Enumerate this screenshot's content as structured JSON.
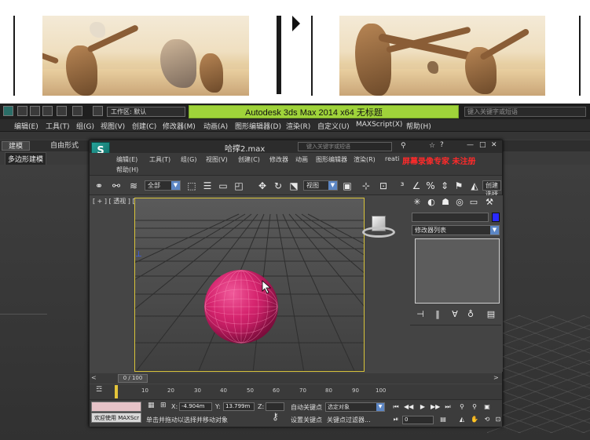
{
  "outer": {
    "title": "Autodesk 3ds Max  2014 x64     无标题",
    "workspace": "工作区: 默认",
    "search_placeholder": "键入关键字或短语",
    "menu": [
      "编辑(E)",
      "工具(T)",
      "组(G)",
      "视图(V)",
      "创建(C)",
      "修改器(M)",
      "动画(A)",
      "图形编辑器(D)",
      "渲染(R)",
      "自定义(U)",
      "MAXScript(X)",
      "帮助(H)"
    ],
    "ribbon_tabs": [
      "建模",
      "自由形式"
    ],
    "ribbon_sub": "多边形建模"
  },
  "inner": {
    "logo": "S",
    "name": "哈撑2.max",
    "search_placeholder": "键入关键字或短语",
    "menu_row1": [
      "编辑(E)",
      "工具(T)",
      "组(G)",
      "视图(V)",
      "创建(C)",
      "修改器",
      "动画",
      "图形编辑器",
      "渲染(R)"
    ],
    "menu_help": "帮助(H)",
    "menu_trunc": "reati",
    "watermark": "屏幕录像专家  未注册",
    "selection_filter": "全部",
    "ref_coord": "视图",
    "named_sel": "创建选择集"
  },
  "viewport": {
    "label": "[ + ] [ 透视 ] [ 平滑 + 高光 + 边面 ]"
  },
  "command_panel": {
    "modifier_list": "修改器列表"
  },
  "timeline": {
    "frame": "0 / 100",
    "ticks": [
      "10",
      "20",
      "30",
      "40",
      "50",
      "60",
      "70",
      "80",
      "90",
      "100"
    ]
  },
  "status": {
    "welcome": "欢迎使用 MAXScr",
    "prompt": "单击并拖动以选择并移动对象",
    "x_label": "X:",
    "x_value": "-4.904m",
    "y_label": "Y:",
    "y_value": "13.799m",
    "z_label": "Z:",
    "auto_key": "自动关键点",
    "selected_dropdown": "选定对象",
    "set_key": "设置关键点",
    "key_filters": "关键点过滤器...",
    "frame_value": "0"
  },
  "colors": {
    "green_title": "#9fd33a",
    "sphere": "#d6256f",
    "watermark": "#ff2a2a",
    "viewport_border": "#d9c43a"
  }
}
